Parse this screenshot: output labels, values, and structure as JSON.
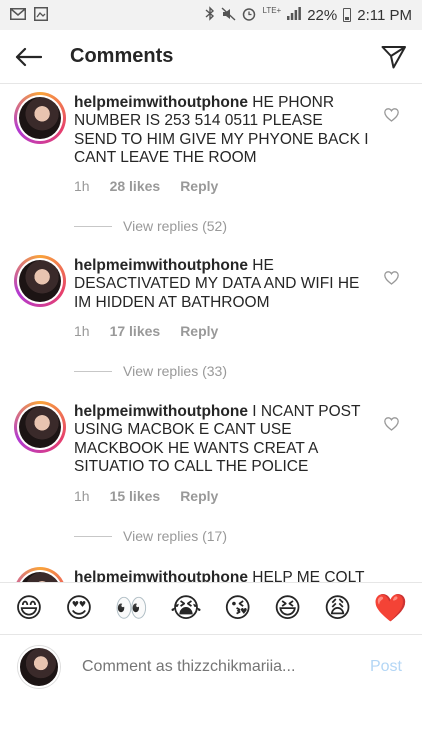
{
  "status_bar": {
    "network": "LTE+",
    "battery": "22%",
    "time": "2:11 PM"
  },
  "header": {
    "title": "Comments"
  },
  "comments": [
    {
      "username": "helpmeimwithoutphone",
      "text": " HE PHONR NUMBER IS 253 514 0511 PLEASE SEND TO HIM GIVE MY PHYONE BACK I CANT LEAVE THE ROOM",
      "time": "1h",
      "likes": "28 likes",
      "reply": "Reply",
      "view_replies": "View replies (52)"
    },
    {
      "username": "helpmeimwithoutphone",
      "text": " HE DESACTIVATED MY DATA AND WIFI HE IM HIDDEN AT BATHROOM",
      "time": "1h",
      "likes": "17 likes",
      "reply": "Reply",
      "view_replies": "View replies (33)"
    },
    {
      "username": "helpmeimwithoutphone",
      "text": " I NCANT POST USING MACBOK E CANT USE MACKBOOK HE WANTS CREAT A SITUATIO TO CALL THE POLICE",
      "time": "1h",
      "likes": "15 likes",
      "reply": "Reply",
      "view_replies": "View replies (17)"
    },
    {
      "username": "helpmeimwithoutphone",
      "text": " HELP ME COLT"
    }
  ],
  "emoji_bar": [
    "😄",
    "😍",
    "👀",
    "😭",
    "😘",
    "😆",
    "😩",
    "❤️"
  ],
  "compose": {
    "placeholder": "Comment as thizzchikmariia...",
    "post_label": "Post"
  },
  "colors": {
    "text": "#262626",
    "meta": "#999999",
    "post_disabled": "#b3d6f5"
  }
}
